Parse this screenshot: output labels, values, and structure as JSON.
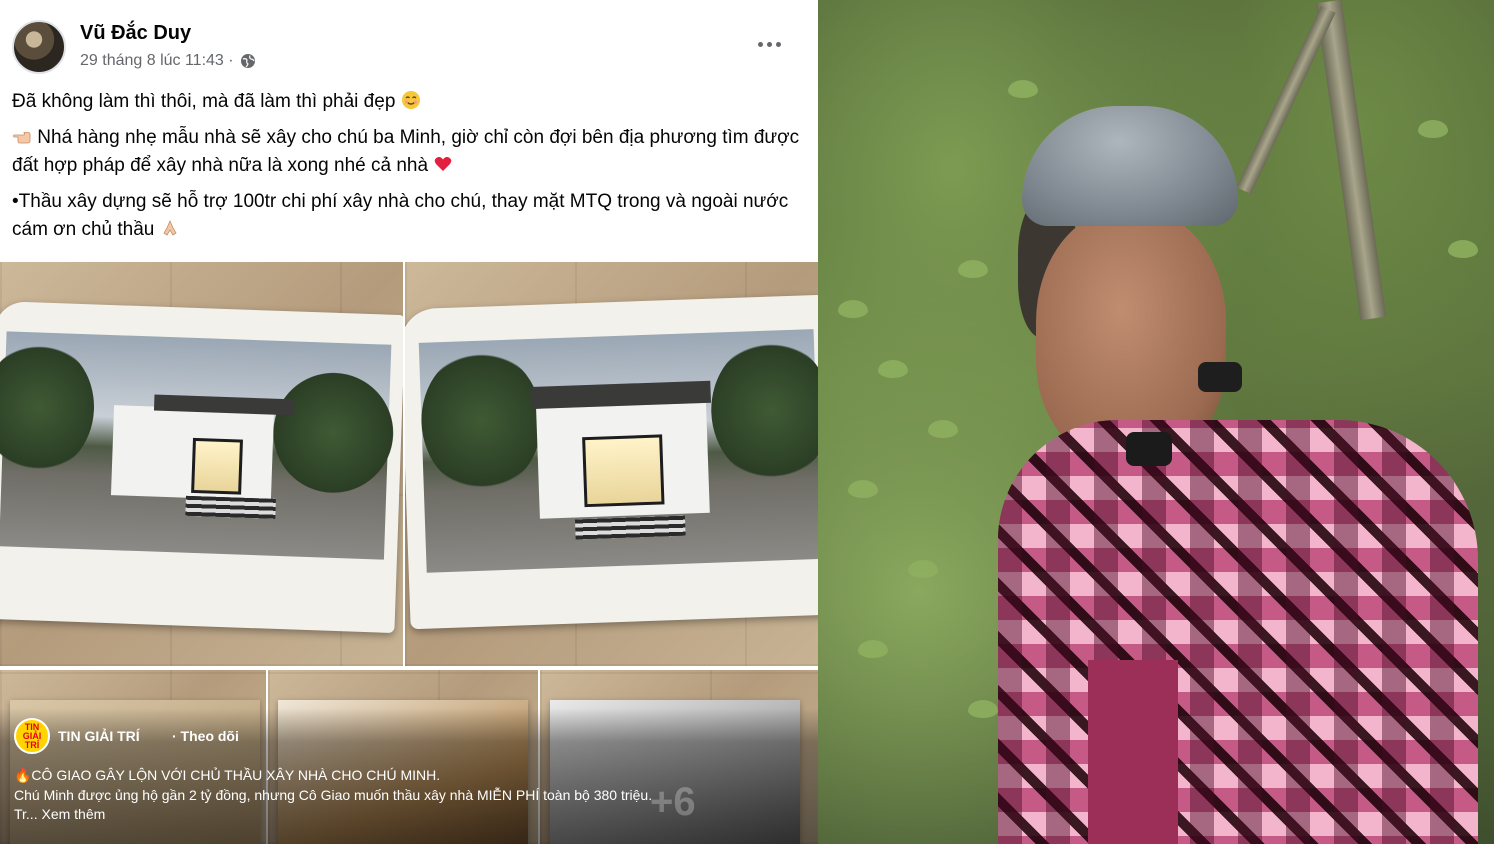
{
  "post": {
    "author": "Vũ Đắc Duy",
    "timestamp": "29 tháng 8 lúc 11:43 ·",
    "paragraphs": [
      "Đã không làm thì thôi, mà đã làm thì phải đẹp",
      "Nhá hàng nhẹ mẫu nhà sẽ xây cho chú ba Minh, giờ chỉ còn đợi bên địa phương tìm được đất hợp pháp để xây nhà nữa là xong nhé cả nhà",
      "•Thầu xây dựng sẽ hỗ trợ 100tr chi phí xây nhà cho chú, thay mặt MTQ trong và ngoài nước cám ơn chủ thầu"
    ],
    "extra_photo_count": "+6",
    "icons": [
      "globe-icon",
      "more-options-icon",
      "smile-emoji",
      "pointing-hand-emoji",
      "red-heart-emoji",
      "praying-hands-emoji"
    ]
  },
  "overlay": {
    "page_name": "TIN GIẢI TRÍ",
    "page_avatar_text": "TIN GIẢI TRÍ",
    "follow_label": "· Theo dõi",
    "caption_line1": "🔥CÔ GIAO GÂY LỘN VỚI CHỦ THẦU XÂY NHÀ CHO CHÚ MINH.",
    "caption_line2": "Chú Minh được ủng hộ gần 2 tỷ đồng, nhưng Cô Giao muốn thầu xây nhà MIỄN PHÍ toàn bộ 380 triệu.",
    "caption_prefix": "Tr...",
    "see_more": "Xem thêm"
  },
  "colors": {
    "primary_text": "#050505",
    "secondary_text": "#65676b",
    "heart": "#e41e3f",
    "page_avatar_bg": "#ffd400"
  }
}
